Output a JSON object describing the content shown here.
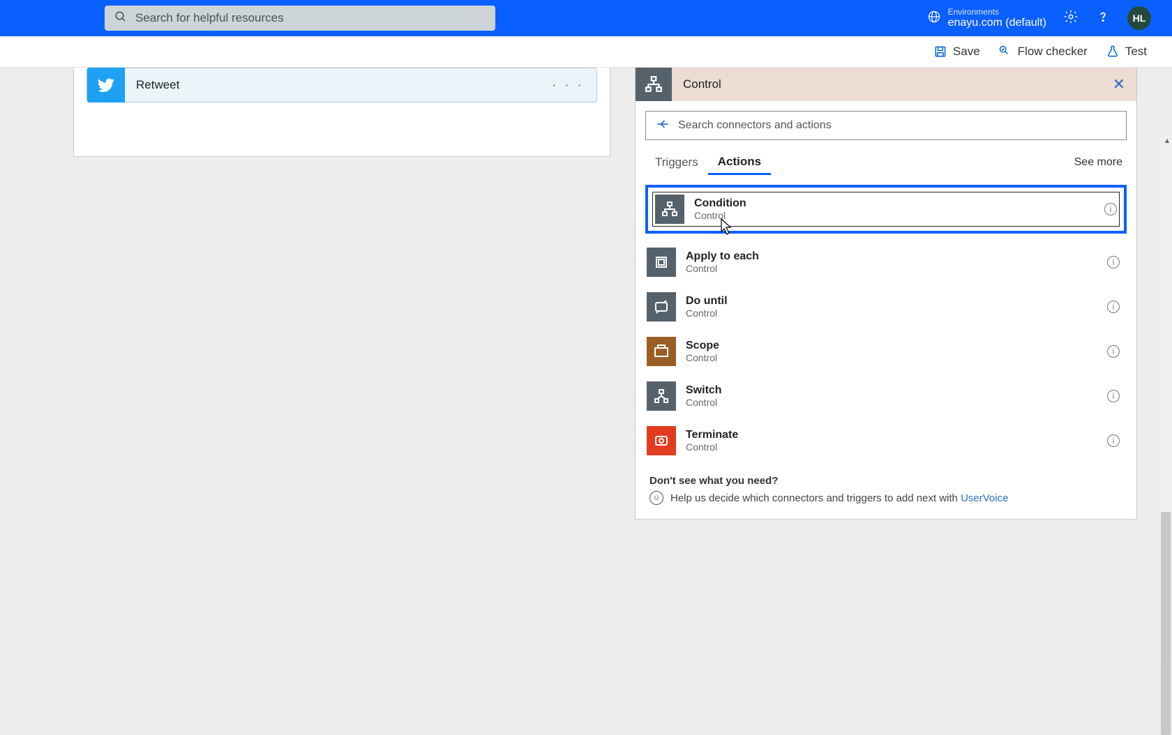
{
  "header": {
    "search_placeholder": "Search for helpful resources",
    "env_label": "Environments",
    "env_value": "enayu.com (default)",
    "avatar": "HL"
  },
  "toolbar": {
    "save": "Save",
    "checker": "Flow checker",
    "test": "Test"
  },
  "left": {
    "card_title": "Retweet",
    "menu": "· · ·"
  },
  "right": {
    "panel_title": "Control",
    "close": "✕",
    "search_placeholder": "Search connectors and actions",
    "tabs": {
      "triggers": "Triggers",
      "actions": "Actions"
    },
    "see_more": "See more",
    "actions": [
      {
        "title": "Condition",
        "subtitle": "Control",
        "icon": "branch",
        "color": "ic-dark",
        "selected": true
      },
      {
        "title": "Apply to each",
        "subtitle": "Control",
        "icon": "list",
        "color": "ic-dark",
        "selected": false
      },
      {
        "title": "Do until",
        "subtitle": "Control",
        "icon": "loop",
        "color": "ic-dark",
        "selected": false
      },
      {
        "title": "Scope",
        "subtitle": "Control",
        "icon": "scope",
        "color": "ic-brown",
        "selected": false
      },
      {
        "title": "Switch",
        "subtitle": "Control",
        "icon": "switch",
        "color": "ic-dark",
        "selected": false
      },
      {
        "title": "Terminate",
        "subtitle": "Control",
        "icon": "terminate",
        "color": "ic-red",
        "selected": false
      }
    ],
    "help_title": "Don't see what you need?",
    "help_text": "Help us decide which connectors and triggers to add next with ",
    "help_link": "UserVoice"
  }
}
